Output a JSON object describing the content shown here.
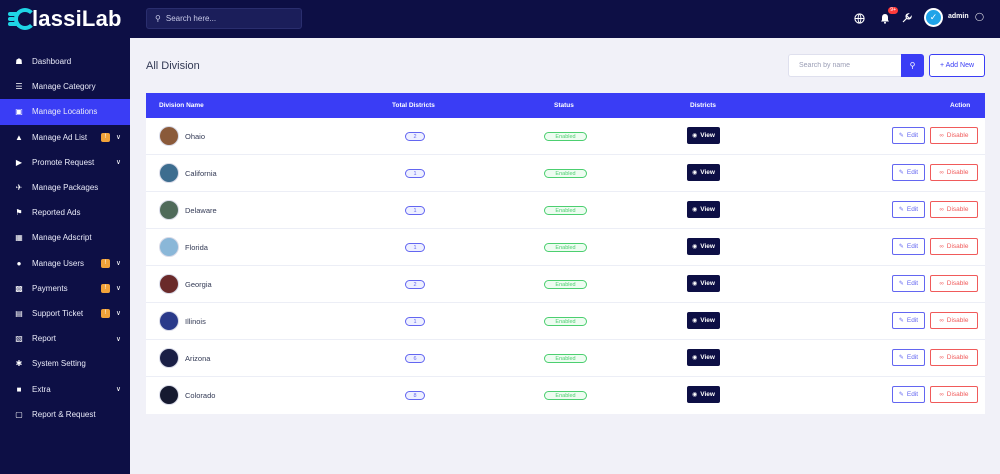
{
  "brand": {
    "name": "lassiLab",
    "color": "#1fd5e6"
  },
  "colors": {
    "primary": "#3a3df5",
    "sidebar": "#0d0f45",
    "success": "#4ccf70",
    "danger": "#f05a5a",
    "badge": "#f2a33a"
  },
  "sidebar": {
    "items": [
      {
        "label": "Dashboard",
        "icon": "home-icon",
        "badge": "",
        "chevron": false,
        "active": false
      },
      {
        "label": "Manage Category",
        "icon": "list-icon",
        "badge": "",
        "chevron": false,
        "active": false
      },
      {
        "label": "Manage Locations",
        "icon": "map-icon",
        "badge": "",
        "chevron": false,
        "active": true
      },
      {
        "label": "Manage Ad List",
        "icon": "megaphone-icon",
        "badge": "!",
        "chevron": true,
        "active": false
      },
      {
        "label": "Promote Request",
        "icon": "bullhorn-icon",
        "badge": "",
        "chevron": true,
        "active": false
      },
      {
        "label": "Manage Packages",
        "icon": "rocket-icon",
        "badge": "",
        "chevron": false,
        "active": false
      },
      {
        "label": "Reported Ads",
        "icon": "flag-icon",
        "badge": "",
        "chevron": false,
        "active": false
      },
      {
        "label": "Manage Adscript",
        "icon": "code-icon",
        "badge": "",
        "chevron": false,
        "active": false
      },
      {
        "label": "Manage Users",
        "icon": "users-icon",
        "badge": "!",
        "chevron": true,
        "active": false
      },
      {
        "label": "Payments",
        "icon": "payment-icon",
        "badge": "!",
        "chevron": true,
        "active": false
      },
      {
        "label": "Support Ticket",
        "icon": "ticket-icon",
        "badge": "!",
        "chevron": true,
        "active": false
      },
      {
        "label": "Report",
        "icon": "report-icon",
        "badge": "",
        "chevron": true,
        "active": false
      },
      {
        "label": "System Setting",
        "icon": "settings-icon",
        "badge": "",
        "chevron": false,
        "active": false
      },
      {
        "label": "Extra",
        "icon": "extra-icon",
        "badge": "",
        "chevron": true,
        "active": false
      },
      {
        "label": "Report & Request",
        "icon": "request-icon",
        "badge": "",
        "chevron": false,
        "active": false
      }
    ]
  },
  "topbar": {
    "search_placeholder": "Search here...",
    "notification_count": "9+",
    "user_name": "admin"
  },
  "main": {
    "title": "All Division",
    "search_placeholder": "Search by name",
    "add_label": "+ Add New",
    "columns": {
      "name": "Division Name",
      "districts_total": "Total Districts",
      "status": "Status",
      "districts": "Districts",
      "action": "Action"
    },
    "view_label": "View",
    "edit_label": "Edit",
    "disable_label": "Disable",
    "rows": [
      {
        "name": "Ohaio",
        "total": "2",
        "status": "Enabled",
        "thumb": "#8a5a3a"
      },
      {
        "name": "California",
        "total": "1",
        "status": "Enabled",
        "thumb": "#3d6d8f"
      },
      {
        "name": "Delaware",
        "total": "1",
        "status": "Enabled",
        "thumb": "#4f6a5a"
      },
      {
        "name": "Florida",
        "total": "1",
        "status": "Enabled",
        "thumb": "#8ab7d8"
      },
      {
        "name": "Georgia",
        "total": "2",
        "status": "Enabled",
        "thumb": "#6a2a2a"
      },
      {
        "name": "Illinois",
        "total": "1",
        "status": "Enabled",
        "thumb": "#2a3a8a"
      },
      {
        "name": "Arizona",
        "total": "6",
        "status": "Enabled",
        "thumb": "#1a1f45"
      },
      {
        "name": "Colorado",
        "total": "8",
        "status": "Enabled",
        "thumb": "#161a30"
      }
    ]
  }
}
